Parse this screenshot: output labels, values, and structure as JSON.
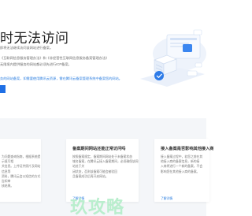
{
  "hero": {
    "title": "时无法访问",
    "desc_1": "即将无法继续访问该网站进行备案。",
    "desc_2": "《互联网信息服务管理办法》和《非经营性互联网信息服务备案管理办法》",
    "desc_3": "无限境内提供服务的网站都必须先进行ICP备案。",
    "link_line": "务的网站备案，如需要使用腾讯云资源，需在腾讯云备案管理系统中备案您的网站。",
    "button_label": ""
  },
  "cards": [
    {
      "title": "",
      "body": "为问题查询指南，根据系统提示填写相\n关信息。上传证件照片及网站信息等\n资料，腾讯云会以短信的方式告知审\n核结果。",
      "link": ""
    },
    {
      "title": "备案期间网站还能正常访问吗",
      "body": "按照备案规定，备案期间网站处于未备案状态\n域名备案，在腾讯云接入备案期间，必须确保该网站处于关\n闭状态，否则该备案可能会被驳回\n且备案成功后再开启网站。",
      "link": "了解详情"
    },
    {
      "title": "接入备案是否影响其他接入商",
      "body": "接入备案过程中，若您之前在其\n他接入商的备案信息，新的接\n入商将进行一个新的备案，不会\n影响您在其他接入商的备案。",
      "link": "了解详情"
    }
  ],
  "watermark": "玖攻略"
}
